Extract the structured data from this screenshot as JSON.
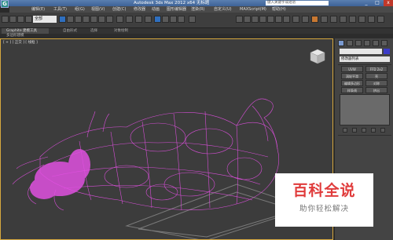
{
  "window": {
    "title": "Autodesk 3ds Max 2012 x64   无标题",
    "search_placeholder": "键入关键字或短语",
    "logo_glyph": "G",
    "controls": [
      "_",
      "□",
      "x"
    ]
  },
  "menus": [
    "编辑(E)",
    "工具(T)",
    "组(G)",
    "视图(V)",
    "创建(C)",
    "修改器",
    "动画",
    "图形编辑器",
    "渲染(R)",
    "自定义(U)",
    "MAXScript(M)",
    "帮助(H)"
  ],
  "toolbar": {
    "selection_filter": "全部"
  },
  "ribbon": {
    "active_tab": "Graphite 建模工具",
    "tabs": [
      "自由形式",
      "选择",
      "对象绘制"
    ],
    "subtitle": "多边形建模"
  },
  "viewport": {
    "label": "[ + ] [ 正交 ] [ 线框 ]",
    "wire_color": "#e050e0",
    "border_color": "#d7a83e"
  },
  "command_panel": {
    "modifier_list": "修改器列表",
    "object_color": "#3c3cc8",
    "buttons": [
      "UVW",
      "FFD 2x2",
      "涡轮平滑",
      "壳",
      "编辑多边形",
      "对称",
      "样条线",
      "挤出"
    ]
  },
  "watermark": {
    "title": "百科全说",
    "subtitle": "助你轻松解决"
  }
}
